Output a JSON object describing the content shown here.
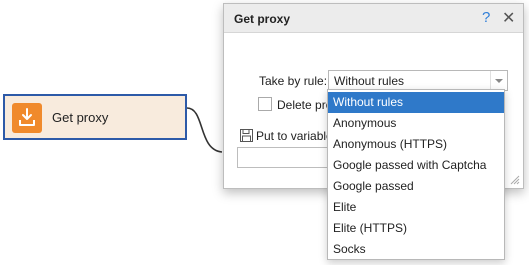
{
  "node": {
    "title": "Get proxy",
    "icon": "download-box-icon",
    "accent_color": "#f08a2c",
    "border_color": "#2d5aa8"
  },
  "dialog": {
    "title": "Get proxy",
    "help_glyph": "?",
    "close_glyph": "✕",
    "rule_label": "Take by rule:",
    "rule_value": "Without rules",
    "delete_label": "Delete pro",
    "put_label": "Put to variable",
    "variable_value": ""
  },
  "dropdown": {
    "options": [
      "Without rules",
      "Anonymous",
      "Anonymous (HTTPS)",
      "Google passed with Captcha",
      "Google passed",
      "Elite",
      "Elite (HTTPS)",
      "Socks"
    ],
    "selected_index": 0,
    "highlight_color": "#2f79c9"
  }
}
